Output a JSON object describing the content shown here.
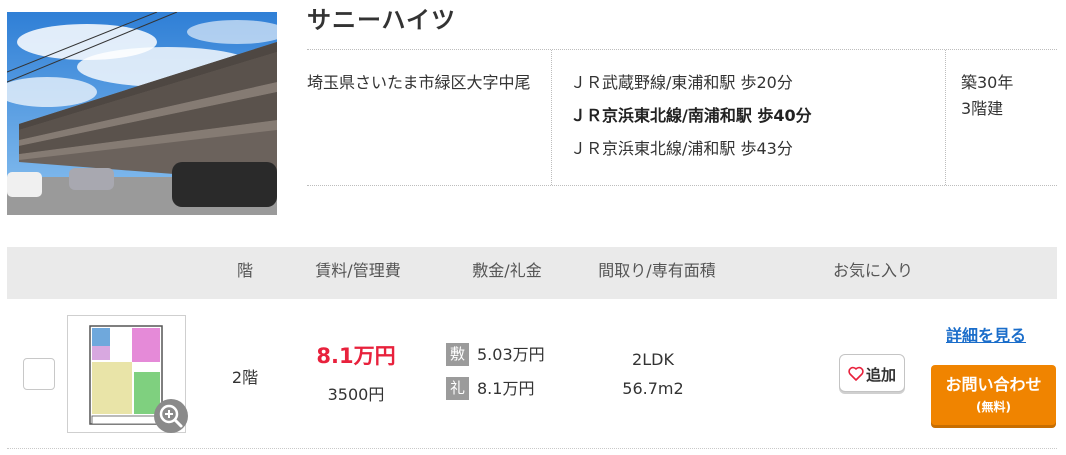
{
  "property": {
    "name": "サニーハイツ",
    "address": "埼玉県さいたま市緑区大字中尾",
    "stations": [
      {
        "text": "ＪＲ武蔵野線/東浦和駅 歩20分",
        "bold": false
      },
      {
        "text": "ＪＲ京浜東北線/南浦和駅 歩40分",
        "bold": true
      },
      {
        "text": "ＪＲ京浜東北線/浦和駅 歩43分",
        "bold": false
      }
    ],
    "age": "築30年",
    "floors": "3階建"
  },
  "table_header": {
    "floor": "階",
    "rent": "賃料/管理費",
    "deposit": "敷金/礼金",
    "layout": "間取り/専有面積",
    "favorite": "お気に入り"
  },
  "listing": {
    "floor": "2階",
    "rent": "8.1万円",
    "management_fee": "3500円",
    "deposit_tag": "敷",
    "deposit": "5.03万円",
    "key_money_tag": "礼",
    "key_money": "8.1万円",
    "layout": "2LDK",
    "area": "56.7m2",
    "favorite_button": "追加",
    "detail_link": "詳細を見る",
    "inquiry_main": "お問い合わせ",
    "inquiry_sub": "(無料)"
  },
  "colors": {
    "rent": "#e8213c",
    "inquiry_button": "#f08400",
    "link": "#1a6dca",
    "header_bg": "#eaeaea"
  }
}
